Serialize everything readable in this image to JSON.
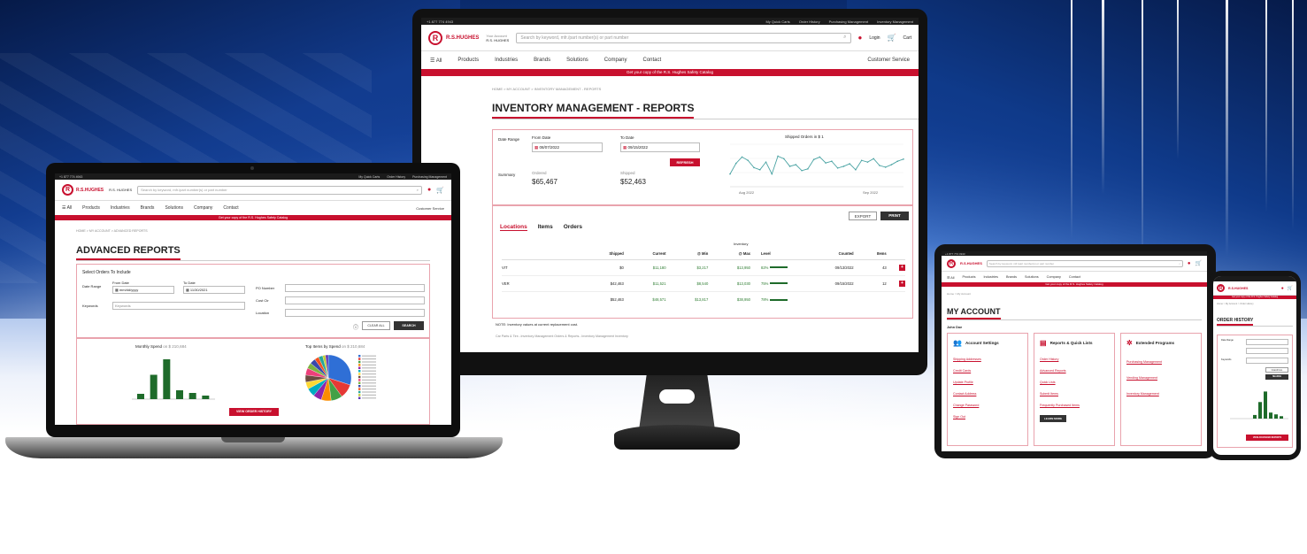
{
  "site": {
    "phone": "+1 877 774 4943",
    "logo_text": "R.S.HUGHES",
    "logo_glyph": "R",
    "account_label": "Your Account",
    "account_name": "R.S. HUGHES",
    "search_placeholder": "Search by keyword, mfr./part number(s) or part number",
    "user_label": "Login",
    "cart_label": "Cart",
    "cart_count": "1",
    "all_label": "All",
    "nav": [
      "Products",
      "Industries",
      "Brands",
      "Solutions",
      "Company",
      "Contact"
    ],
    "customer_service": "Customer Service",
    "top_links": [
      "My Quick Carts",
      "Order History",
      "Purchasing Management",
      "Inventory Management"
    ],
    "promo": "Get your copy of the R.S. Hughes Safety Catalog"
  },
  "monitor": {
    "breadcrumb": "HOME > MY ACCOUNT > INVENTORY MANAGEMENT - REPORTS",
    "title": "INVENTORY MANAGEMENT - REPORTS",
    "date_range_label": "Date Range",
    "from_label": "From Date",
    "from_value": "08/07/2022",
    "to_label": "To Date",
    "to_value": "09/15/2022",
    "refresh": "REFRESH",
    "chart_title": "Shipped Orders in $ 1",
    "summary_label": "Summary",
    "ordered_label": "Ordered",
    "ordered_value": "$65,467",
    "shipped_label": "Shipped",
    "shipped_value": "$52,463",
    "export": "EXPORT",
    "print": "PRINT",
    "tabs": [
      "Locations",
      "Items",
      "Orders"
    ],
    "inventory_label": "Inventory",
    "columns": [
      "Shipped",
      "Current",
      "@ Min",
      "@ Max",
      "Level",
      "Counted",
      "Items"
    ],
    "rows": [
      {
        "loc": "VIT",
        "shipped": "$0",
        "current": "$11,180",
        "min": "$3,217",
        "max": "$13,950",
        "level": "82%",
        "counted": "09/13/2022",
        "items": "43"
      },
      {
        "loc": "VER",
        "shipped": "$42,463",
        "current": "$11,521",
        "min": "$8,540",
        "max": "$13,030",
        "level": "75%",
        "counted": "09/15/2022",
        "items": "12"
      },
      {
        "loc": "",
        "shipped": "$52,463",
        "current": "$48,571",
        "min": "$13,817",
        "max": "$38,950",
        "level": "78%",
        "counted": "",
        "items": ""
      }
    ],
    "note": "NOTE: Inventory values at current replacement cost.",
    "footer_note": "Car Parts & Tire...Inventory Management Orders & Reports...Inventory Management Inventory"
  },
  "laptop": {
    "breadcrumb": "HOME > MY ACCOUNT > ADVANCED REPORTS",
    "title": "ADVANCED REPORTS",
    "select_label": "Select Orders To Include",
    "date_range_label": "Date Range",
    "from_label": "From Date",
    "from_value": "mm/dd/yyyy",
    "to_label": "To Date",
    "to_value": "11/30/2021",
    "po_label": "PO Number",
    "keywords_label": "Keywords",
    "keywords_placeholder": "Keywords",
    "cost_center_label": "Cost Ctr",
    "location_label": "Location",
    "clear": "CLEAR ALL",
    "search": "SEARCH",
    "chart1_title": "Monthly Spend",
    "chart1_suffix": "on $ 210,684",
    "chart2_title": "Top Items by Spend",
    "chart2_suffix": "on $ 210,684",
    "view_button": "VIEW ORDER HISTORY"
  },
  "tablet": {
    "breadcrumb": "Home > My Account",
    "title": "MY ACCOUNT",
    "user": "John Doe",
    "cards": [
      {
        "title": "Account Settings",
        "links": [
          "Shipping Addresses",
          "Credit Cards",
          "Update Profile",
          "Contact Address",
          "Change Password",
          "Sign Out"
        ]
      },
      {
        "title": "Reports & Quick Lists",
        "links": [
          "Order History",
          "Advanced Reports",
          "Quick Lists",
          "Submit Items",
          "Frequently Purchased Items"
        ],
        "button": "LEARN MORE"
      },
      {
        "title": "Extended Programs",
        "links": [
          "Purchasing Management",
          "Vending Management",
          "Inventory Management"
        ]
      }
    ]
  },
  "phone": {
    "title": "ORDER HISTORY",
    "crumb": "Home > My Account > Order History",
    "search": "SEARCH",
    "view_button": "VIEW ADVANCED REPORTS"
  },
  "chart_data": [
    {
      "type": "line",
      "title": "Shipped Orders in $ 1",
      "x_labels": [
        "Aug 2022",
        "Sep 2022"
      ],
      "values": [
        30,
        55,
        70,
        62,
        45,
        40,
        58,
        30,
        72,
        66,
        48,
        52,
        38,
        42,
        64,
        70,
        56,
        60,
        44,
        48,
        54,
        40,
        62,
        58,
        66,
        50,
        46,
        52,
        60,
        65
      ]
    },
    {
      "type": "bar",
      "title": "Monthly Spend",
      "categories": [
        "",
        "",
        "",
        "",
        "",
        ""
      ],
      "values": [
        12,
        55,
        90,
        20,
        14,
        8
      ]
    },
    {
      "type": "pie",
      "title": "Top Items by Spend",
      "values": [
        30,
        10,
        8,
        7,
        6,
        6,
        5,
        5,
        5,
        4,
        4,
        3,
        3,
        2,
        2
      ]
    }
  ],
  "colors": {
    "brand_red": "#c8102e",
    "chart_green": "#1e6b2a",
    "line_teal": "#4aa3a3"
  }
}
